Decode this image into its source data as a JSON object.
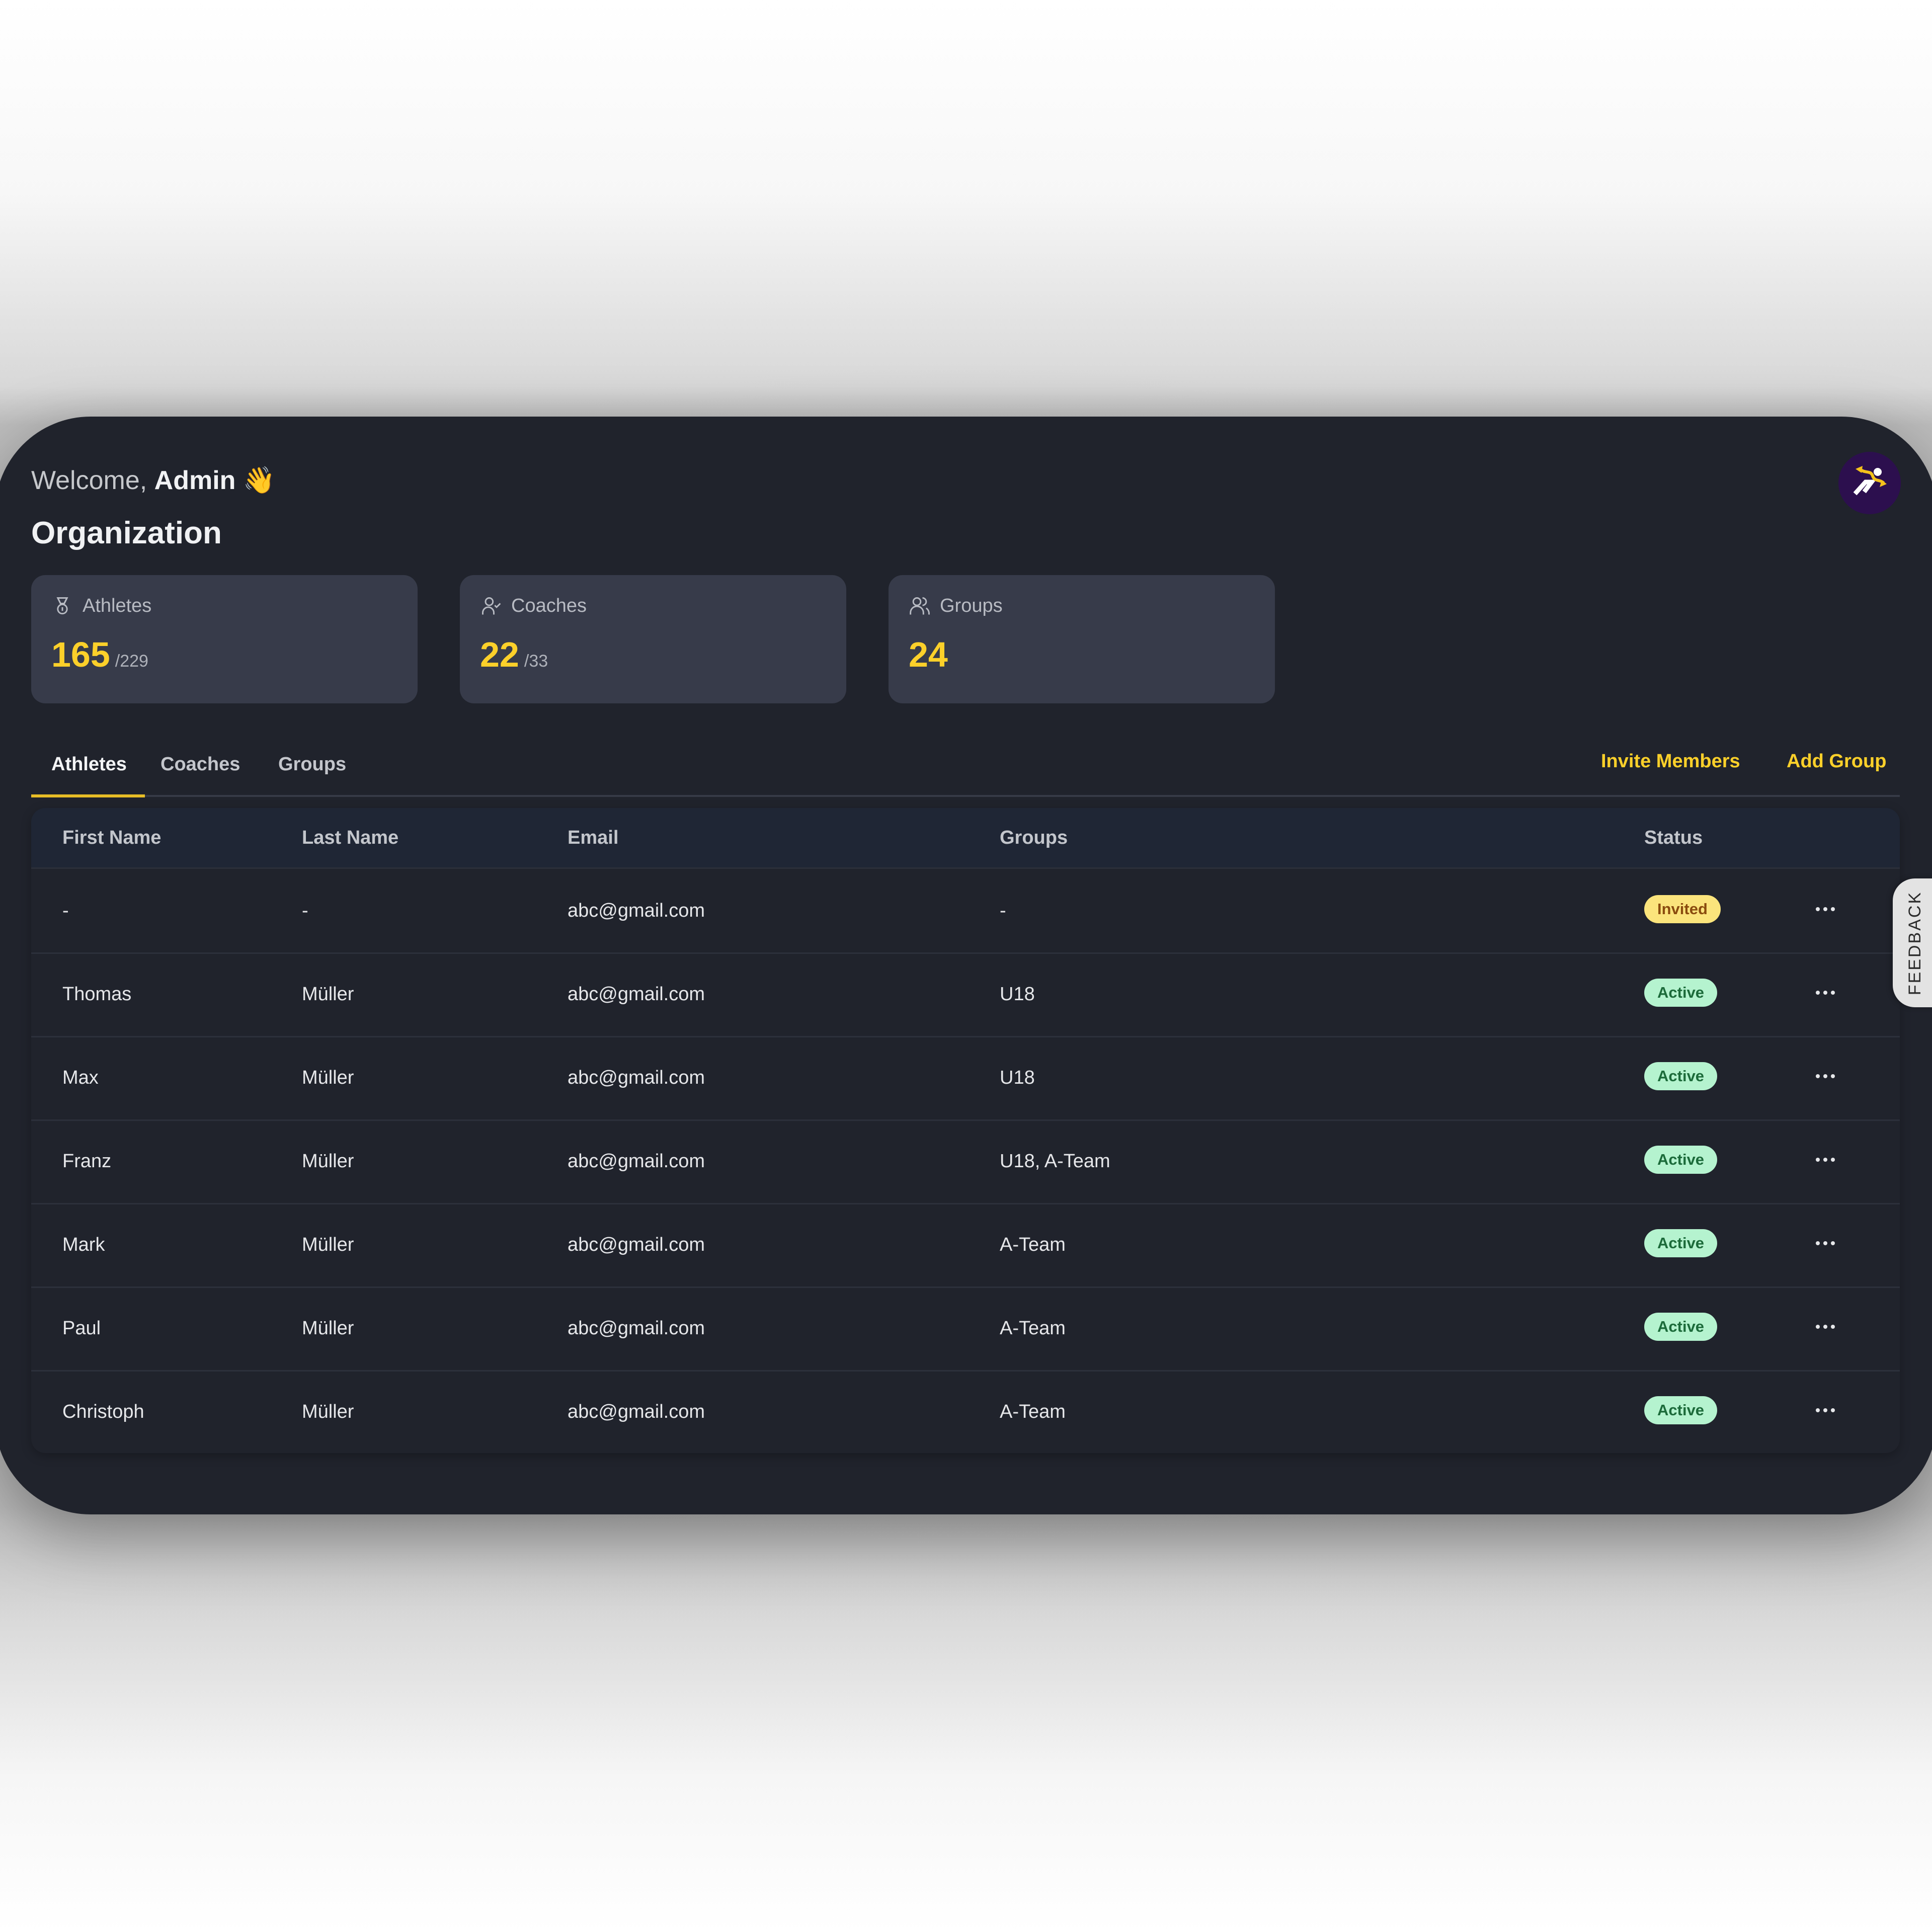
{
  "header": {
    "welcome_prefix": "Welcome, ",
    "user_name": "Admin",
    "wave_emoji": "👋",
    "page_title": "Organization",
    "logo_icon": "running-athlete-logo"
  },
  "stats": [
    {
      "icon": "medal-icon",
      "label": "Athletes",
      "value": "165",
      "total": "/229"
    },
    {
      "icon": "user-check-icon",
      "label": "Coaches",
      "value": "22",
      "total": "/33"
    },
    {
      "icon": "users-icon",
      "label": "Groups",
      "value": "24",
      "total": ""
    }
  ],
  "tabs": [
    {
      "label": "Athletes",
      "active": true
    },
    {
      "label": "Coaches",
      "active": false
    },
    {
      "label": "Groups",
      "active": false
    }
  ],
  "actions": {
    "invite_members": "Invite Members",
    "add_group": "Add Group"
  },
  "table": {
    "columns": [
      "First Name",
      "Last Name",
      "Email",
      "Groups",
      "Status"
    ],
    "rows": [
      {
        "first_name": "-",
        "last_name": "-",
        "email": "abc@gmail.com",
        "groups": "-",
        "status": "Invited"
      },
      {
        "first_name": "Thomas",
        "last_name": "Müller",
        "email": "abc@gmail.com",
        "groups": "U18",
        "status": "Active"
      },
      {
        "first_name": "Max",
        "last_name": "Müller",
        "email": "abc@gmail.com",
        "groups": "U18",
        "status": "Active"
      },
      {
        "first_name": "Franz",
        "last_name": "Müller",
        "email": "abc@gmail.com",
        "groups": "U18, A-Team",
        "status": "Active"
      },
      {
        "first_name": "Mark",
        "last_name": "Müller",
        "email": "abc@gmail.com",
        "groups": "A-Team",
        "status": "Active"
      },
      {
        "first_name": "Paul",
        "last_name": "Müller",
        "email": "abc@gmail.com",
        "groups": "A-Team",
        "status": "Active"
      },
      {
        "first_name": "Christoph",
        "last_name": "Müller",
        "email": "abc@gmail.com",
        "groups": "A-Team",
        "status": "Active"
      }
    ]
  },
  "feedback_label": "FEEDBACK",
  "colors": {
    "accent": "#fcd02a",
    "background": "#20232c",
    "card": "#373b4a",
    "invited_bg": "#fbe47c",
    "invited_text": "#8a4b0e",
    "active_bg": "#b5f3cf",
    "active_text": "#1c6b3a",
    "logo_bg": "#2c0f4e"
  }
}
